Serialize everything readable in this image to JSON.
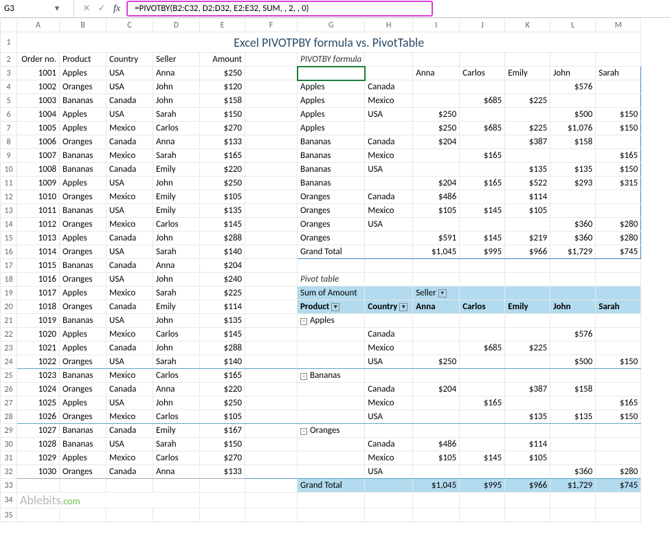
{
  "formula_bar": {
    "cell_ref": "G3",
    "formula": "=PIVOTBY(B2:C32, D2:D32, E2:E32, SUM, , 2, , 0)"
  },
  "title": "Excel PIVOTPBY formula vs. PivotTable",
  "section_labels": {
    "pivotby": "PIVOTBY formula",
    "pivottable": "Pivot table"
  },
  "source": {
    "headers": [
      "Order no.",
      "Product",
      "Country",
      "Seller",
      "Amount"
    ],
    "rows": [
      [
        "1001",
        "Apples",
        "USA",
        "Anna",
        "$250"
      ],
      [
        "1002",
        "Oranges",
        "USA",
        "John",
        "$120"
      ],
      [
        "1003",
        "Bananas",
        "Canada",
        "John",
        "$158"
      ],
      [
        "1004",
        "Apples",
        "USA",
        "Sarah",
        "$150"
      ],
      [
        "1005",
        "Apples",
        "Mexico",
        "Carlos",
        "$270"
      ],
      [
        "1006",
        "Oranges",
        "Canada",
        "Anna",
        "$133"
      ],
      [
        "1007",
        "Bananas",
        "Mexico",
        "Sarah",
        "$165"
      ],
      [
        "1008",
        "Bananas",
        "Canada",
        "Emily",
        "$220"
      ],
      [
        "1009",
        "Apples",
        "USA",
        "John",
        "$250"
      ],
      [
        "1010",
        "Oranges",
        "Mexico",
        "Emily",
        "$105"
      ],
      [
        "1011",
        "Bananas",
        "USA",
        "Emily",
        "$135"
      ],
      [
        "1012",
        "Oranges",
        "Mexico",
        "Carlos",
        "$145"
      ],
      [
        "1013",
        "Apples",
        "Canada",
        "John",
        "$288"
      ],
      [
        "1014",
        "Oranges",
        "USA",
        "Sarah",
        "$140"
      ],
      [
        "1015",
        "Bananas",
        "Canada",
        "Anna",
        "$204"
      ],
      [
        "1016",
        "Oranges",
        "USA",
        "John",
        "$240"
      ],
      [
        "1017",
        "Apples",
        "Mexico",
        "Sarah",
        "$225"
      ],
      [
        "1018",
        "Oranges",
        "Canada",
        "Emily",
        "$114"
      ],
      [
        "1019",
        "Bananas",
        "USA",
        "John",
        "$135"
      ],
      [
        "1020",
        "Apples",
        "Mexico",
        "Carlos",
        "$145"
      ],
      [
        "1021",
        "Apples",
        "Canada",
        "John",
        "$288"
      ],
      [
        "1022",
        "Oranges",
        "USA",
        "Sarah",
        "$140"
      ],
      [
        "1023",
        "Bananas",
        "Mexico",
        "Carlos",
        "$165"
      ],
      [
        "1024",
        "Oranges",
        "Canada",
        "Anna",
        "$220"
      ],
      [
        "1025",
        "Apples",
        "USA",
        "John",
        "$250"
      ],
      [
        "1026",
        "Oranges",
        "Mexico",
        "Carlos",
        "$105"
      ],
      [
        "1027",
        "Bananas",
        "Canada",
        "Emily",
        "$167"
      ],
      [
        "1028",
        "Bananas",
        "USA",
        "Sarah",
        "$150"
      ],
      [
        "1029",
        "Apples",
        "Mexico",
        "Carlos",
        "$270"
      ],
      [
        "1030",
        "Oranges",
        "Canada",
        "Anna",
        "$133"
      ]
    ]
  },
  "pivotby": {
    "col_headers": [
      "Anna",
      "Carlos",
      "Emily",
      "John",
      "Sarah"
    ],
    "rows": [
      {
        "prod": "Apples",
        "ctry": "Canada",
        "vals": [
          "",
          "",
          "",
          "$576",
          ""
        ]
      },
      {
        "prod": "Apples",
        "ctry": "Mexico",
        "vals": [
          "",
          "$685",
          "$225",
          "",
          ""
        ]
      },
      {
        "prod": "Apples",
        "ctry": "USA",
        "vals": [
          "$250",
          "",
          "",
          "$500",
          "$150"
        ]
      },
      {
        "prod": "Apples",
        "ctry": "",
        "vals": [
          "$250",
          "$685",
          "$225",
          "$1,076",
          "$150"
        ]
      },
      {
        "prod": "Bananas",
        "ctry": "Canada",
        "vals": [
          "$204",
          "",
          "$387",
          "$158",
          ""
        ]
      },
      {
        "prod": "Bananas",
        "ctry": "Mexico",
        "vals": [
          "",
          "$165",
          "",
          "",
          "$165"
        ]
      },
      {
        "prod": "Bananas",
        "ctry": "USA",
        "vals": [
          "",
          "",
          "$135",
          "$135",
          "$150"
        ]
      },
      {
        "prod": "Bananas",
        "ctry": "",
        "vals": [
          "$204",
          "$165",
          "$522",
          "$293",
          "$315"
        ]
      },
      {
        "prod": "Oranges",
        "ctry": "Canada",
        "vals": [
          "$486",
          "",
          "$114",
          "",
          ""
        ]
      },
      {
        "prod": "Oranges",
        "ctry": "Mexico",
        "vals": [
          "$105",
          "$145",
          "$105",
          "",
          ""
        ]
      },
      {
        "prod": "Oranges",
        "ctry": "USA",
        "vals": [
          "",
          "",
          "",
          "$360",
          "$280"
        ]
      },
      {
        "prod": "Oranges",
        "ctry": "",
        "vals": [
          "$591",
          "$145",
          "$219",
          "$360",
          "$280"
        ]
      }
    ],
    "grand_label": "Grand Total",
    "grand_vals": [
      "$1,045",
      "$995",
      "$966",
      "$1,729",
      "$745"
    ]
  },
  "pivottable": {
    "sum_label": "Sum of Amount",
    "seller_label": "Seller",
    "row_labels": {
      "product": "Product",
      "country": "Country"
    },
    "col_headers": [
      "Anna",
      "Carlos",
      "Emily",
      "John",
      "Sarah"
    ],
    "groups": [
      {
        "name": "Apples",
        "rows": [
          {
            "ctry": "Canada",
            "vals": [
              "",
              "",
              "",
              "$576",
              ""
            ]
          },
          {
            "ctry": "Mexico",
            "vals": [
              "",
              "$685",
              "$225",
              "",
              ""
            ]
          },
          {
            "ctry": "USA",
            "vals": [
              "$250",
              "",
              "",
              "$500",
              "$150"
            ]
          }
        ]
      },
      {
        "name": "Bananas",
        "rows": [
          {
            "ctry": "Canada",
            "vals": [
              "$204",
              "",
              "$387",
              "$158",
              ""
            ]
          },
          {
            "ctry": "Mexico",
            "vals": [
              "",
              "$165",
              "",
              "",
              "$165"
            ]
          },
          {
            "ctry": "USA",
            "vals": [
              "",
              "",
              "$135",
              "$135",
              "$150"
            ]
          }
        ]
      },
      {
        "name": "Oranges",
        "rows": [
          {
            "ctry": "Canada",
            "vals": [
              "$486",
              "",
              "$114",
              "",
              ""
            ]
          },
          {
            "ctry": "Mexico",
            "vals": [
              "$105",
              "$145",
              "$105",
              "",
              ""
            ]
          },
          {
            "ctry": "USA",
            "vals": [
              "",
              "",
              "",
              "$360",
              "$280"
            ]
          }
        ]
      }
    ],
    "grand_label": "Grand Total",
    "grand_vals": [
      "$1,045",
      "$995",
      "$966",
      "$1,729",
      "$745"
    ]
  },
  "logo": {
    "brand": "Ablebits",
    "suffix": ".com"
  }
}
